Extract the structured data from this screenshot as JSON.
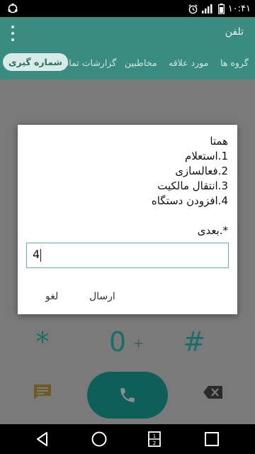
{
  "status_bar": {
    "time": "۱۰:۴۱"
  },
  "app_bar": {
    "title": "تلفن"
  },
  "tabs": [
    {
      "label": "شماره گیری",
      "active": true
    },
    {
      "label": "گزارشات تماس"
    },
    {
      "label": "مخاطبین"
    },
    {
      "label": "مورد علاقه"
    },
    {
      "label": "گروه ها"
    }
  ],
  "keypad": {
    "star": "*",
    "zero": "0",
    "plus": "+",
    "hash": "#"
  },
  "dialog": {
    "lines": [
      "همتا",
      "1.استعلام",
      "2.فعالسازی",
      "3.انتقال مالکیت",
      "4.افزودن دستگاه",
      "",
      "*.بعدی"
    ],
    "input_value": "4",
    "send_label": "ارسال",
    "cancel_label": "لغو"
  },
  "colors": {
    "accent": "#3a8c80",
    "call_button": "#0d5f58",
    "input_border": "#5fb6ab"
  }
}
